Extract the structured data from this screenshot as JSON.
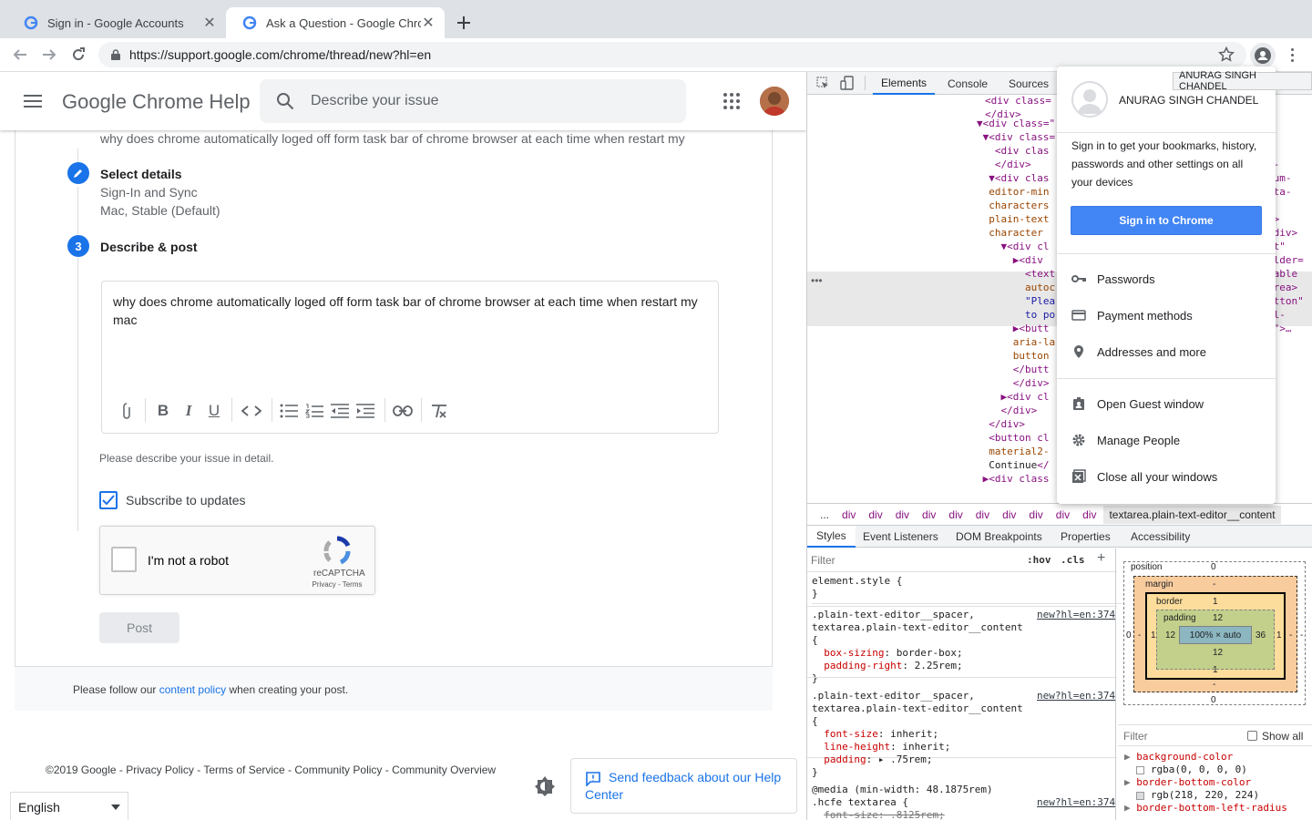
{
  "browser": {
    "tabs": [
      {
        "title": "Sign in - Google Accounts",
        "active": false
      },
      {
        "title": "Ask a Question - Google Chrome",
        "active": true
      }
    ],
    "url": "https://support.google.com/chrome/thread/new?hl=en"
  },
  "header": {
    "app_title": "Google Chrome Help",
    "search_placeholder": "Describe your issue"
  },
  "form": {
    "question_text": "why does chrome automatically loged off form task bar of chrome browser at each time when restart my",
    "step2": {
      "title": "Select details",
      "product": "Sign-In and Sync",
      "platform": "Mac, Stable (Default)"
    },
    "step3": {
      "number": "3",
      "title": "Describe & post"
    },
    "body_text": "why does chrome automatically loged off form task bar of chrome browser at each time when restart my mac",
    "hint": "Please describe your issue in detail.",
    "subscribe_label": "Subscribe to updates",
    "subscribe_checked": true,
    "captcha": {
      "label": "I'm not a robot",
      "brand": "reCAPTCHA",
      "links": "Privacy - Terms"
    },
    "post_label": "Post"
  },
  "policy": {
    "prefix": "Please follow our ",
    "link": "content policy",
    "suffix": " when creating your post."
  },
  "footer": {
    "text": "©2019 Google - Privacy Policy - Terms of Service - Community Policy - Community Overview",
    "feedback": "Send feedback about our Help Center",
    "language": "English"
  },
  "devtools": {
    "tabs": [
      "Elements",
      "Console",
      "Sources"
    ],
    "active_tab": "Elements",
    "breadcrumbs": [
      "...",
      "div",
      "div",
      "div",
      "div",
      "div",
      "div",
      "div",
      "div",
      "div",
      "div",
      "textarea.plain-text-editor__content"
    ],
    "style_tabs": [
      "Styles",
      "Event Listeners",
      "DOM Breakpoints",
      "Properties",
      "Accessibility"
    ],
    "filter_placeholder": "Filter",
    "hov": ":hov",
    "cls": ".cls",
    "src": "new?hl=en:374",
    "element_style": "element.style {",
    "rule1_selector": ".plain-text-editor__spacer,\ntextarea.plain-text-editor__content\n{",
    "rule1_props": [
      [
        "box-sizing",
        "border-box;"
      ],
      [
        "padding-right",
        "2.25rem;"
      ]
    ],
    "rule2_selector": ".plain-text-editor__spacer,\ntextarea.plain-text-editor__content\n{",
    "rule2_props": [
      [
        "font-size",
        "inherit;"
      ],
      [
        "line-height",
        "inherit;"
      ],
      [
        "padding",
        "▸ .75rem;"
      ]
    ],
    "media": "@media (min-width: 48.1875rem)",
    "rule3_selector": ".hcfe textarea {",
    "rule3_prop": "font-size: .8125rem;",
    "computed_filter": "Filter",
    "show_all": "Show all",
    "computed": [
      {
        "name": "background-color",
        "value": "rgba(0, 0, 0, 0)"
      },
      {
        "name": "border-bottom-color",
        "value": "rgb(218, 220, 224)"
      },
      {
        "name": "border-bottom-left-radius",
        "value": ""
      }
    ],
    "boxmodel": {
      "position": "position",
      "position_val": "0",
      "margin": "margin",
      "margin_val": "-",
      "border": "border",
      "border_val": "1",
      "padding": "padding",
      "padding_val": "12",
      "content": "100% × auto",
      "left_margin": "0",
      "left_border": "1",
      "left_padding": "12",
      "right_padding": "36",
      "right_border": "1",
      "right_margin": "-",
      "bottom_padding": "12",
      "bottom_border": "1",
      "bottom_margin": "-",
      "bottom_position": "0"
    }
  },
  "profile_menu": {
    "name": "ANURAG SINGH CHANDEL",
    "tooltip": "ANURAG SINGH CHANDEL",
    "description": "Sign in to get your bookmarks, history, passwords and other settings on all your devices",
    "signin_button": "Sign in to Chrome",
    "items1": [
      "Passwords",
      "Payment methods",
      "Addresses and more"
    ],
    "items2": [
      "Open Guest window",
      "Manage People",
      "Close all your windows"
    ]
  },
  "colors": {
    "accent": "#1a73e8",
    "link": "#1a73e8"
  }
}
